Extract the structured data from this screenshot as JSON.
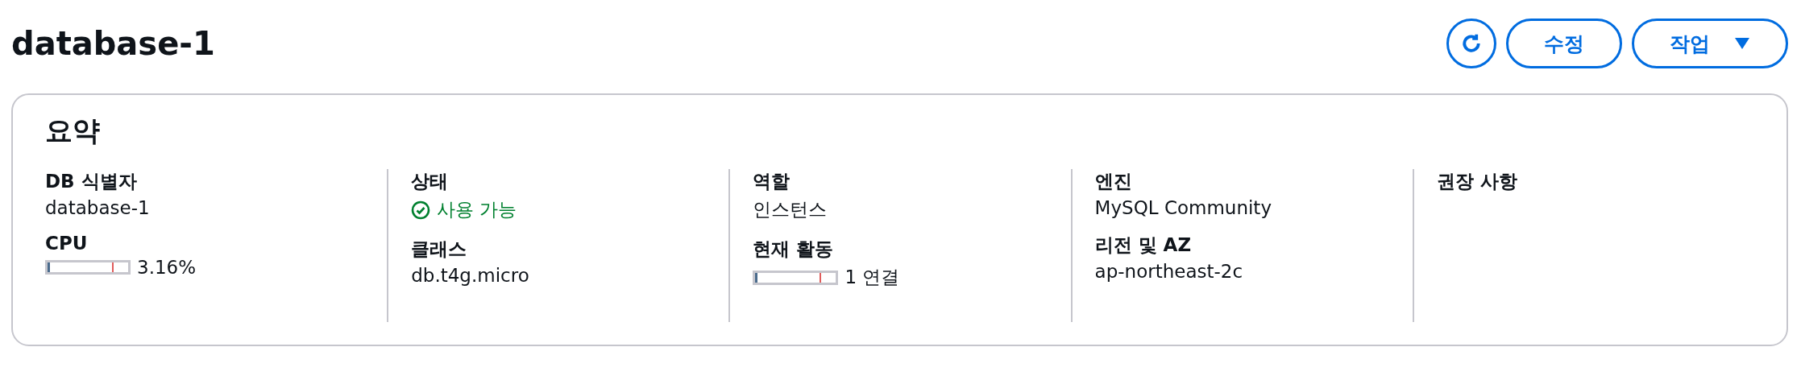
{
  "header": {
    "title": "database-1",
    "buttons": [
      {
        "kind": "refresh"
      },
      {
        "kind": "text",
        "label": "수정"
      },
      {
        "kind": "dropdown",
        "label": "작업"
      }
    ]
  },
  "summary": {
    "title": "요약",
    "columns": [
      {
        "fields": [
          {
            "label": "DB 식별자",
            "kind": "text",
            "value": "database-1"
          },
          {
            "label": "CPU",
            "kind": "meter",
            "value": "3.16%",
            "level": 0.03
          }
        ]
      },
      {
        "fields": [
          {
            "label": "상태",
            "kind": "status",
            "value": "사용 가능"
          },
          {
            "label": "클래스",
            "kind": "text",
            "value": "db.t4g.micro"
          }
        ]
      },
      {
        "fields": [
          {
            "label": "역할",
            "kind": "text",
            "value": "인스턴스"
          },
          {
            "label": "현재 활동",
            "kind": "meter",
            "value": "1 연결",
            "level": 0.02
          }
        ]
      },
      {
        "fields": [
          {
            "label": "엔진",
            "kind": "text",
            "value": "MySQL Community"
          },
          {
            "label": "리전 및 AZ",
            "kind": "text",
            "value": "ap-northeast-2c"
          }
        ]
      },
      {
        "fields": [
          {
            "label": "권장 사항",
            "kind": "label"
          }
        ]
      }
    ]
  }
}
